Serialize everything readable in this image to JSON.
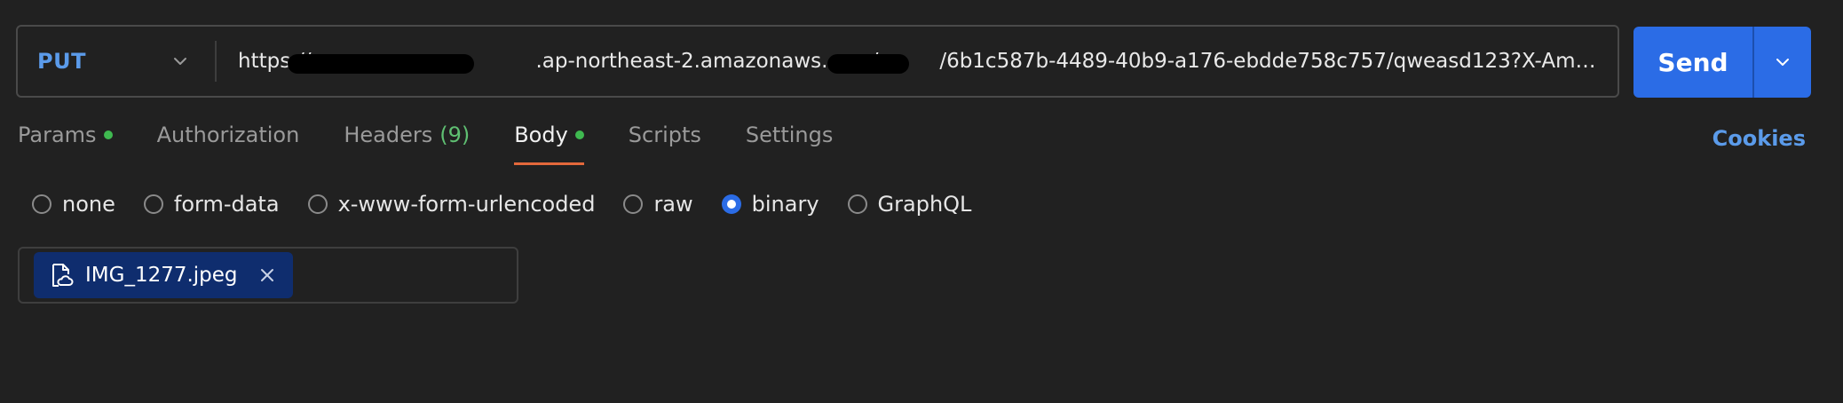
{
  "request": {
    "method": "PUT",
    "url_visible": "https://           .ap-northeast-2.amazonaws.com/   /6b1c587b-4489-40b9-a176-ebdde758c757/qweasd123?X-Amz-A..."
  },
  "send": {
    "label": "Send"
  },
  "tabs": [
    {
      "label": "Params",
      "indicator": "dot"
    },
    {
      "label": "Authorization"
    },
    {
      "label": "Headers",
      "count": "(9)"
    },
    {
      "label": "Body",
      "indicator": "dot",
      "active": true
    },
    {
      "label": "Scripts"
    },
    {
      "label": "Settings"
    }
  ],
  "cookies": {
    "label": "Cookies"
  },
  "body_types": [
    {
      "label": "none",
      "checked": false
    },
    {
      "label": "form-data",
      "checked": false
    },
    {
      "label": "x-www-form-urlencoded",
      "checked": false
    },
    {
      "label": "raw",
      "checked": false
    },
    {
      "label": "binary",
      "checked": true
    },
    {
      "label": "GraphQL",
      "checked": false
    }
  ],
  "file": {
    "name": "IMG_1277.jpeg",
    "icon": "file-cloud-icon",
    "remove_icon": "close-icon"
  },
  "colors": {
    "accent": "#2b6ce6",
    "method": "#5b9bea",
    "active_tab_underline": "#e3683b",
    "indicator": "#3fb950",
    "chip_bg": "#0f2d6e"
  }
}
